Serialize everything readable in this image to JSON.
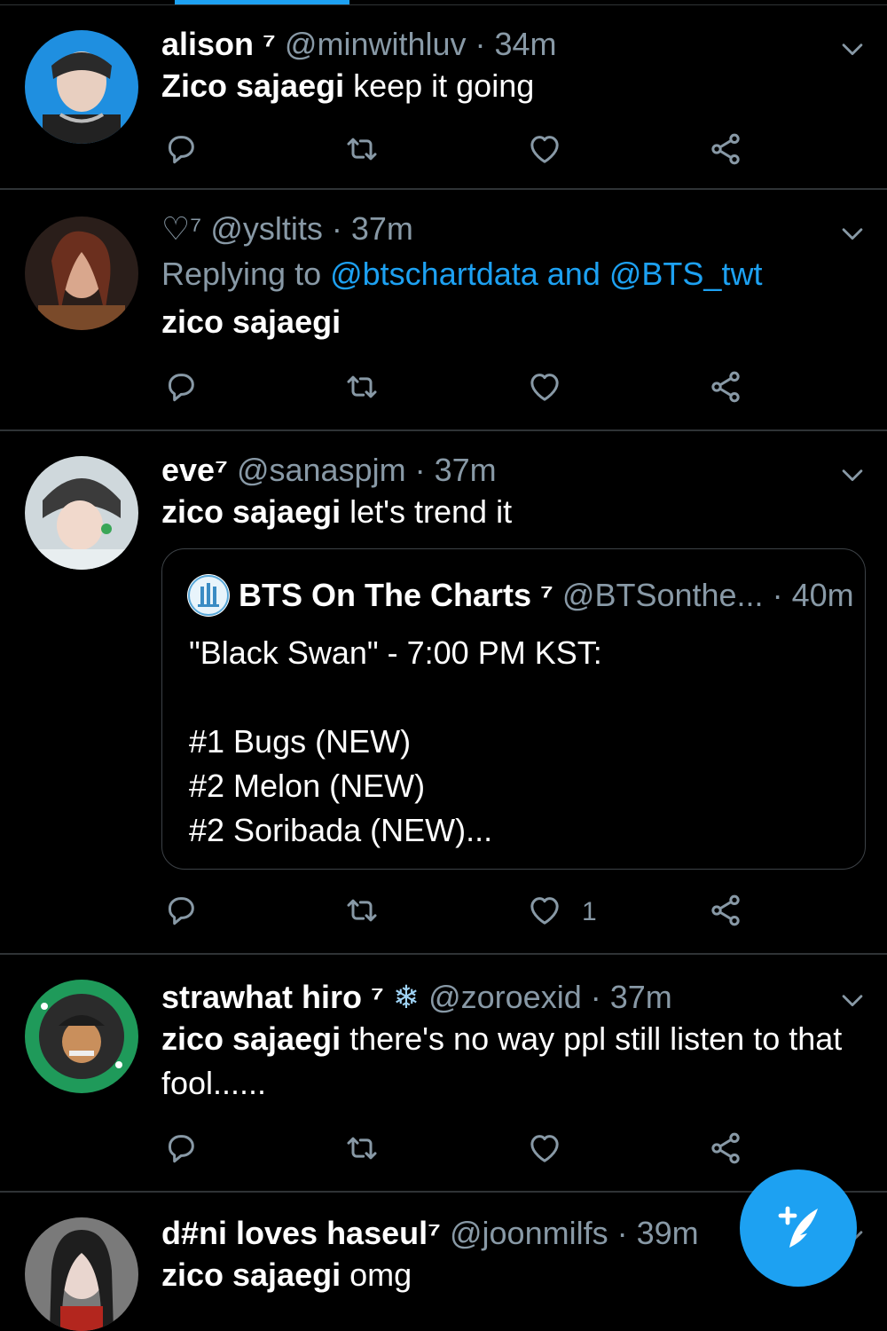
{
  "timeline": {
    "tweets": [
      {
        "name": "alison ⁷",
        "handle": "@minwithluv",
        "time": "· 34m",
        "text_bold": "Zico sajaegi",
        "text_rest": " keep it going",
        "like_count": ""
      },
      {
        "name": "♡⁷",
        "handle": "@ysltits",
        "time": "· 37m",
        "reply_prefix": "Replying to ",
        "reply_to_1": "@btschartdata",
        "reply_and": " and ",
        "reply_to_2": "@BTS_twt",
        "text_bold": "zico sajaegi",
        "text_rest": "",
        "like_count": ""
      },
      {
        "name": "eve⁷",
        "handle": "@sanaspjm",
        "time": "· 37m",
        "text_bold": "zico sajaegi",
        "text_rest": " let's trend it",
        "like_count": "1",
        "quote": {
          "name": "BTS On The Charts ⁷",
          "handle": "@BTSonthe...",
          "time": "· 40m",
          "text": "\"Black Swan\" - 7:00 PM KST:\n\n#1 Bugs (NEW)\n#2 Melon (NEW)\n#2 Soribada (NEW)..."
        }
      },
      {
        "name": "strawhat hiro ⁷",
        "badge": "❄",
        "handle": "@zoroexid",
        "time": "· 37m",
        "text_bold": "zico sajaegi",
        "text_rest": " there's no way ppl still listen to that fool......",
        "like_count": ""
      },
      {
        "name": "d#ni loves haseul⁷",
        "handle": "@joonmilfs",
        "time": "· 39m",
        "text_bold": "zico sajaegi",
        "text_rest": " omg"
      }
    ]
  },
  "icons": {
    "reply": "reply-icon",
    "retweet": "retweet-icon",
    "like": "heart-icon",
    "share": "share-icon",
    "more": "chevron-down-icon",
    "compose": "compose-tweet-icon"
  },
  "colors": {
    "background": "#000000",
    "accent": "#1da1f2",
    "muted_text": "#8899a6",
    "divider": "#2f3336"
  }
}
